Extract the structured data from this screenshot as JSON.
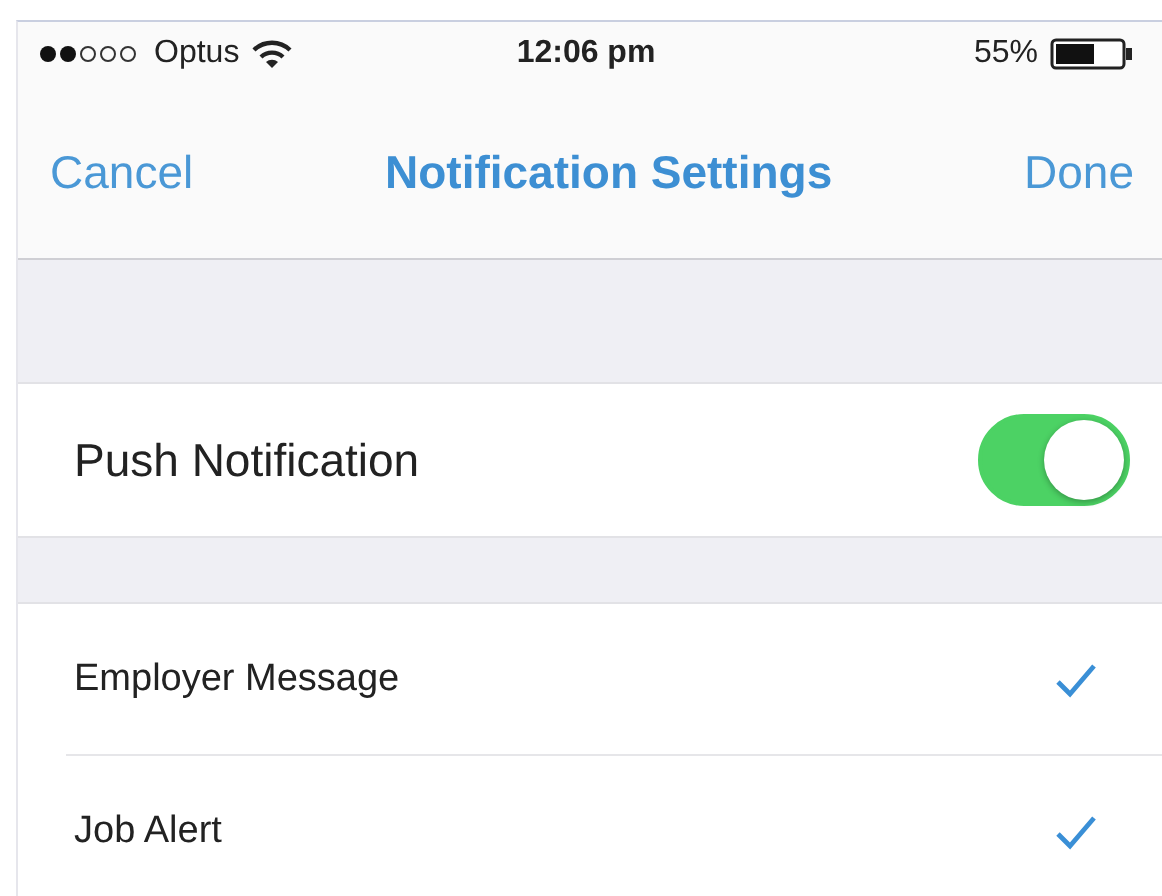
{
  "status_bar": {
    "carrier": "Optus",
    "time": "12:06 pm",
    "battery": "55%"
  },
  "nav_bar": {
    "left": "Cancel",
    "title": "Notification Settings",
    "right": "Done"
  },
  "push": {
    "label": "Push Notification",
    "on": true
  },
  "items": [
    {
      "label": "Employer Message",
      "checked": true
    },
    {
      "label": "Job Alert",
      "checked": true
    }
  ]
}
